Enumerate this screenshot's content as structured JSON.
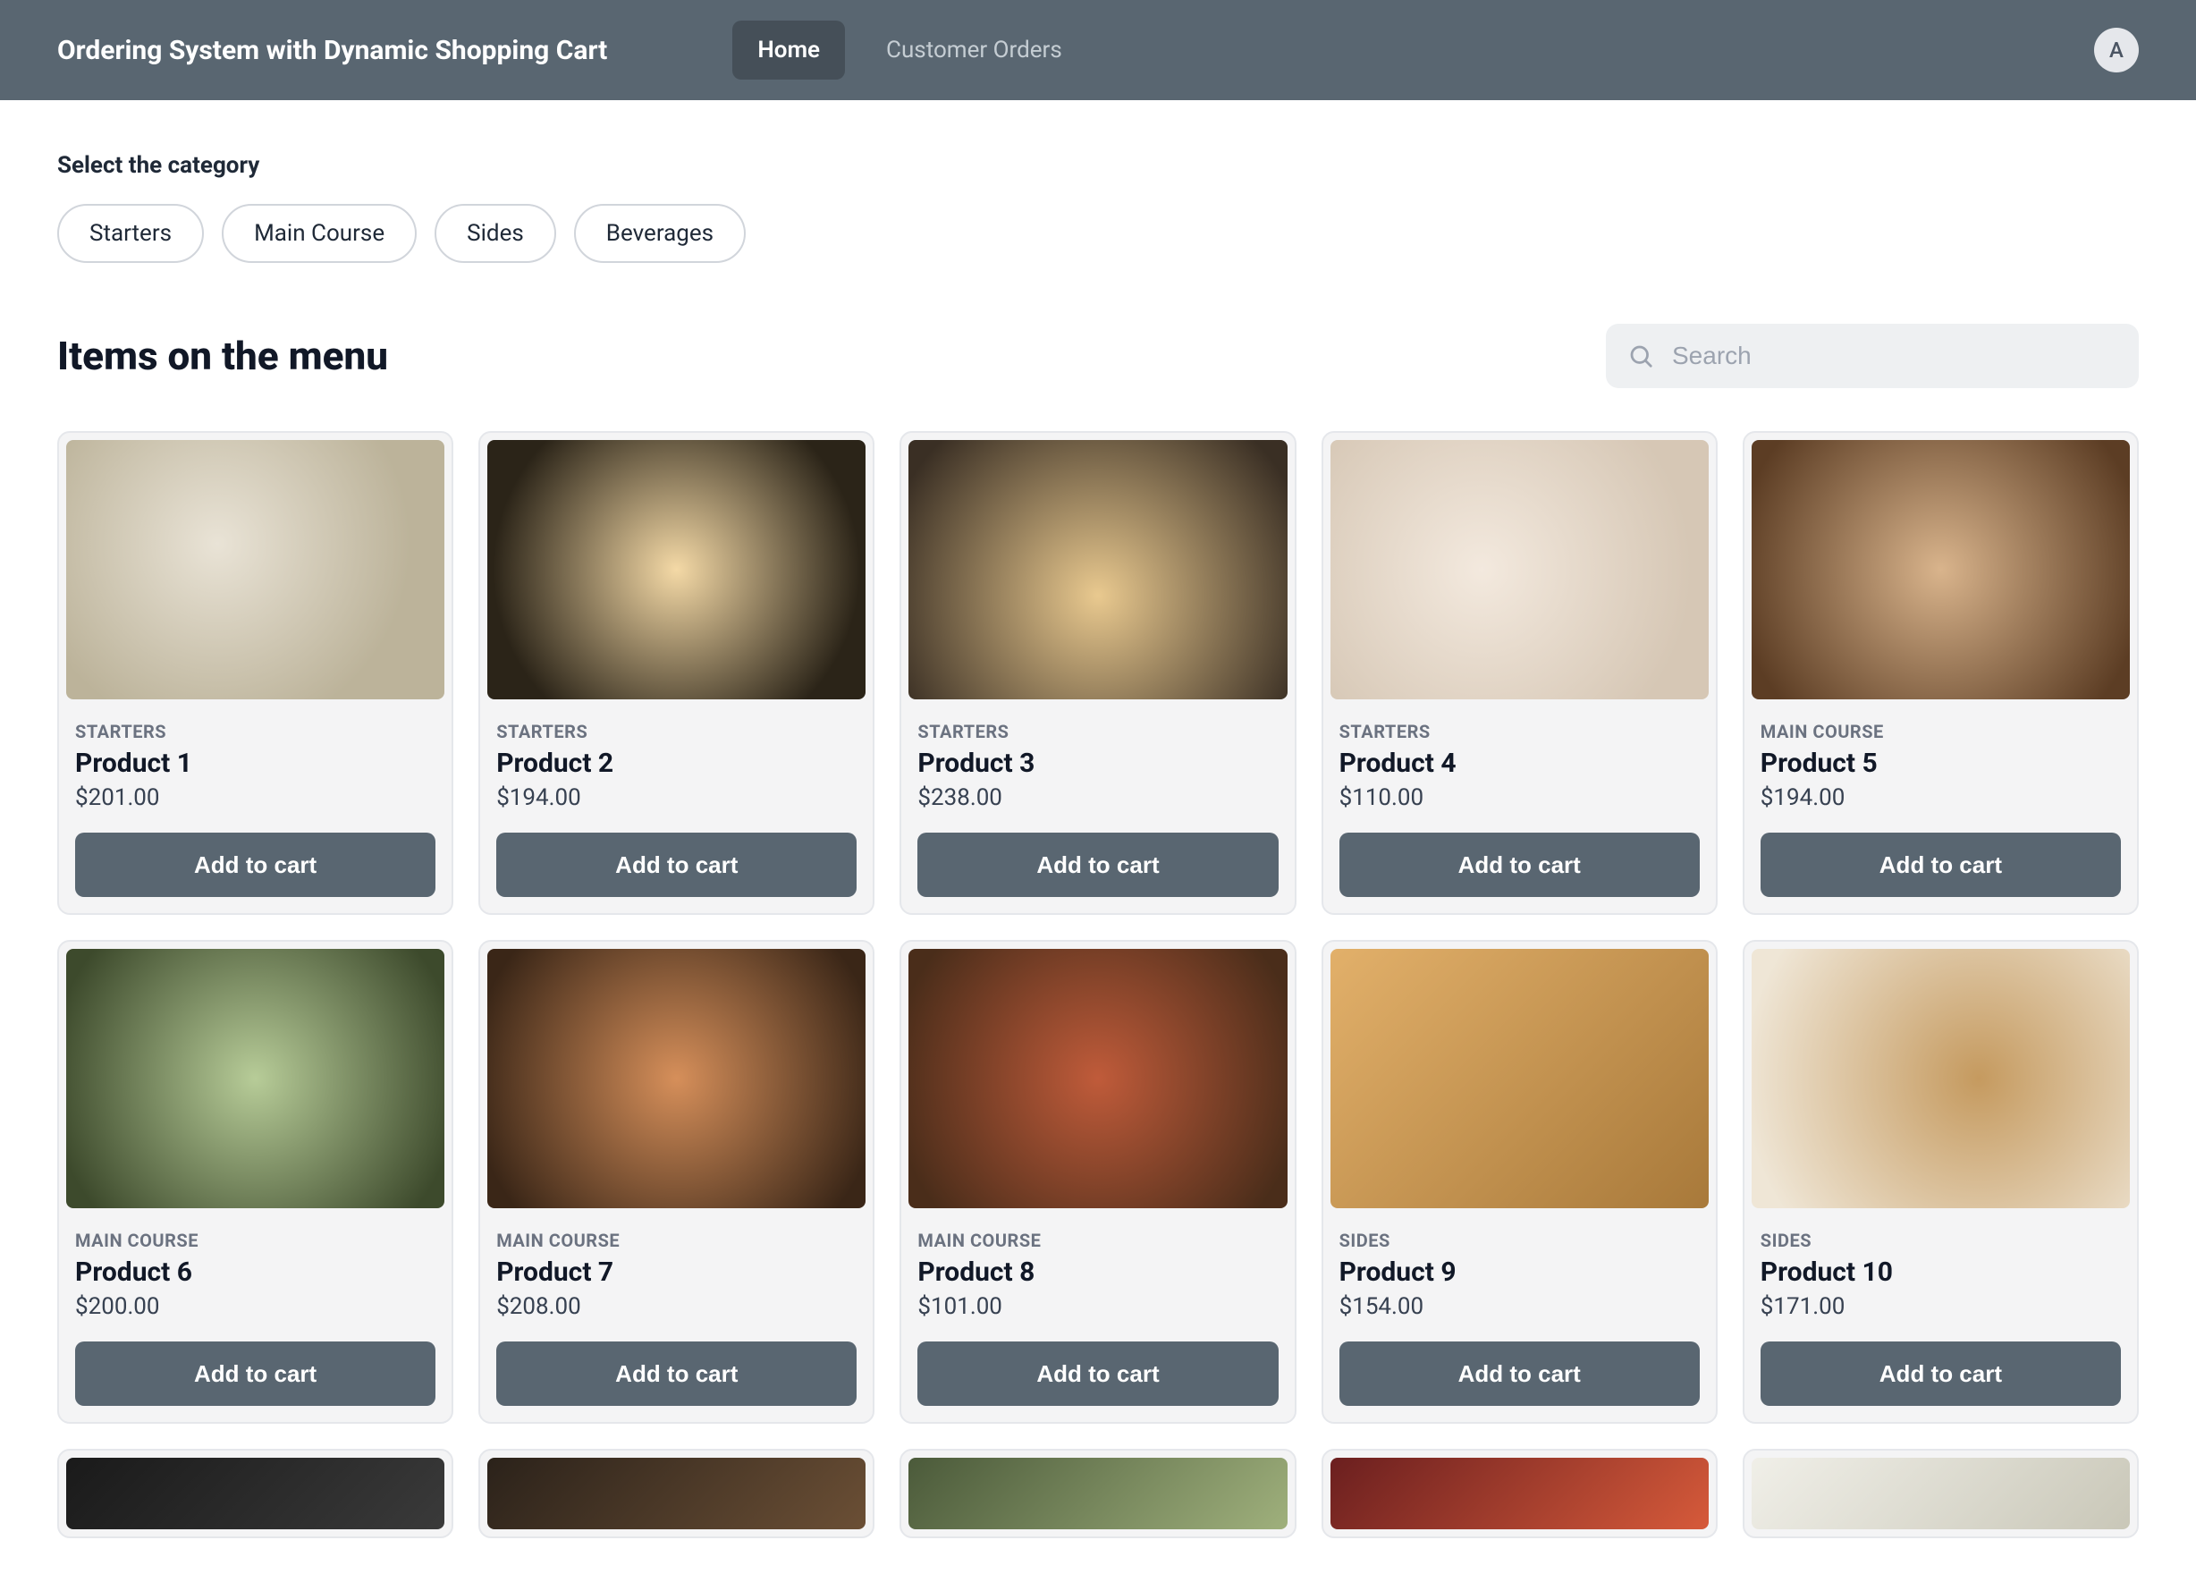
{
  "header": {
    "title": "Ordering System with Dynamic Shopping Cart",
    "nav": [
      {
        "label": "Home",
        "active": true
      },
      {
        "label": "Customer Orders",
        "active": false
      }
    ],
    "avatar_initial": "A"
  },
  "category": {
    "label": "Select the category",
    "chips": [
      "Starters",
      "Main Course",
      "Sides",
      "Beverages"
    ]
  },
  "menu": {
    "title": "Items on the menu",
    "search_placeholder": "Search"
  },
  "products": [
    {
      "category": "STARTERS",
      "name": "Product 1",
      "price": "$201.00",
      "button": "Add to cart"
    },
    {
      "category": "STARTERS",
      "name": "Product 2",
      "price": "$194.00",
      "button": "Add to cart"
    },
    {
      "category": "STARTERS",
      "name": "Product 3",
      "price": "$238.00",
      "button": "Add to cart"
    },
    {
      "category": "STARTERS",
      "name": "Product 4",
      "price": "$110.00",
      "button": "Add to cart"
    },
    {
      "category": "MAIN COURSE",
      "name": "Product 5",
      "price": "$194.00",
      "button": "Add to cart"
    },
    {
      "category": "MAIN COURSE",
      "name": "Product 6",
      "price": "$200.00",
      "button": "Add to cart"
    },
    {
      "category": "MAIN COURSE",
      "name": "Product 7",
      "price": "$208.00",
      "button": "Add to cart"
    },
    {
      "category": "MAIN COURSE",
      "name": "Product 8",
      "price": "$101.00",
      "button": "Add to cart"
    },
    {
      "category": "SIDES",
      "name": "Product 9",
      "price": "$154.00",
      "button": "Add to cart"
    },
    {
      "category": "SIDES",
      "name": "Product 10",
      "price": "$171.00",
      "button": "Add to cart"
    }
  ]
}
